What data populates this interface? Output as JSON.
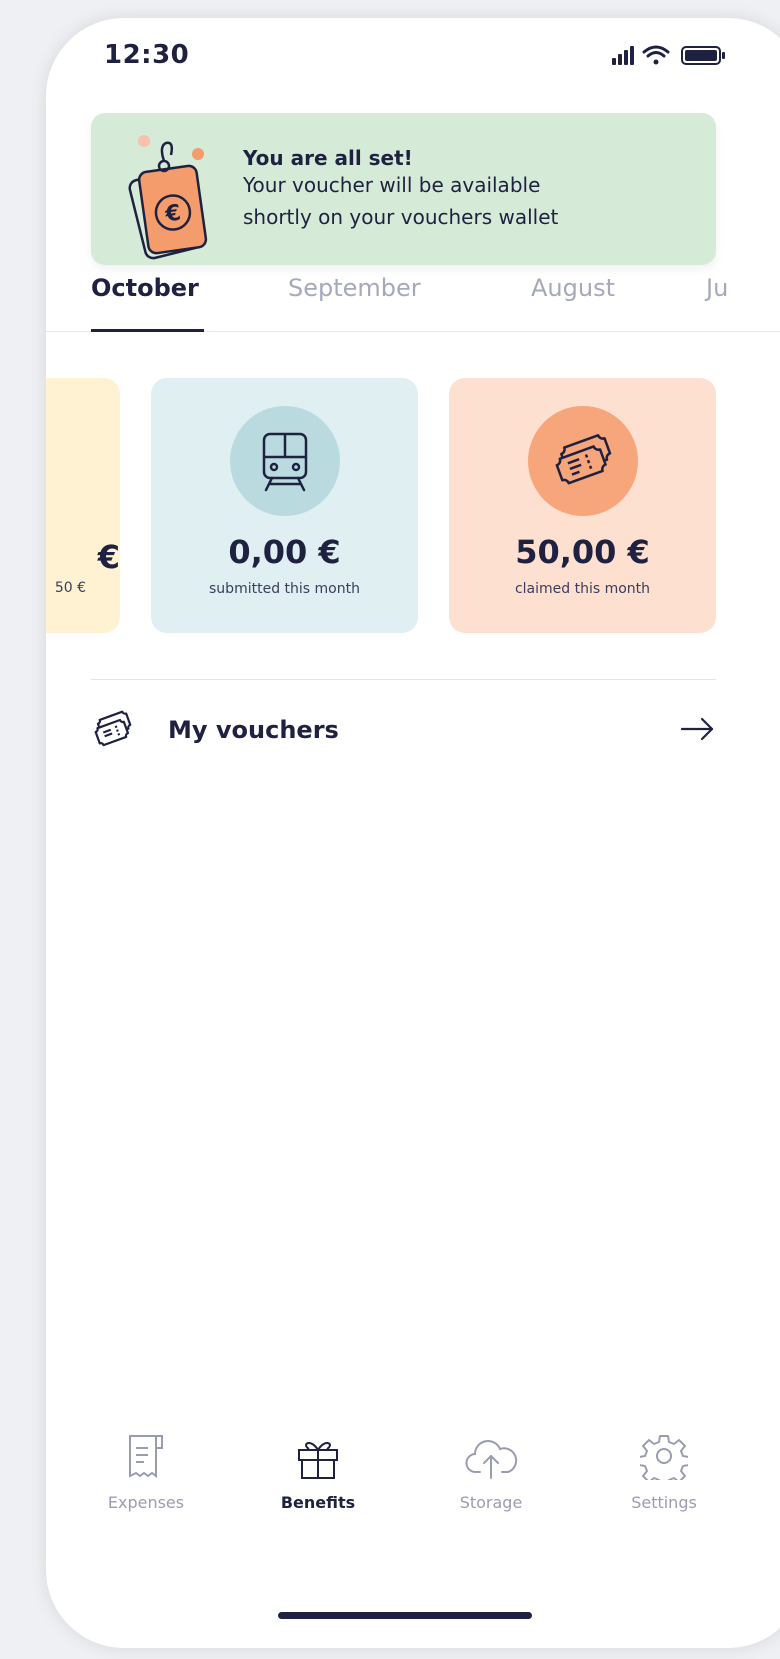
{
  "status_bar": {
    "time": "12:30"
  },
  "toast": {
    "title": "You are all set!",
    "line1": "Your voucher will be available",
    "line2": "shortly on your vouchers wallet"
  },
  "tabs": [
    {
      "label": "October",
      "active": true
    },
    {
      "label": "September",
      "active": false
    },
    {
      "label": "August",
      "active": false
    },
    {
      "label": "Ju",
      "active": false
    }
  ],
  "cards": {
    "partial": {
      "amount": "€",
      "sub": "50 €",
      "color": "#fff2d2"
    },
    "submitted": {
      "amount": "0,00 €",
      "sub": "submitted this month",
      "color": "#dfeff2",
      "icon": "train-icon"
    },
    "claimed": {
      "amount": "50,00 €",
      "sub": "claimed this month",
      "color": "#fde0d0",
      "icon": "voucher-icon"
    }
  },
  "my_vouchers": {
    "label": "My vouchers",
    "icon": "voucher-icon",
    "arrow": "arrow-right-icon"
  },
  "bottom_nav": [
    {
      "label": "Expenses",
      "icon": "receipt-icon",
      "active": false
    },
    {
      "label": "Benefits",
      "icon": "gift-icon",
      "active": true
    },
    {
      "label": "Storage",
      "icon": "cloud-upload-icon",
      "active": false
    },
    {
      "label": "Settings",
      "icon": "gear-icon",
      "active": false
    }
  ],
  "colors": {
    "primary": "#1f2140",
    "accent": "#f59c6c",
    "toast_bg": "#d6ead8",
    "muted": "#a6a9ba"
  }
}
